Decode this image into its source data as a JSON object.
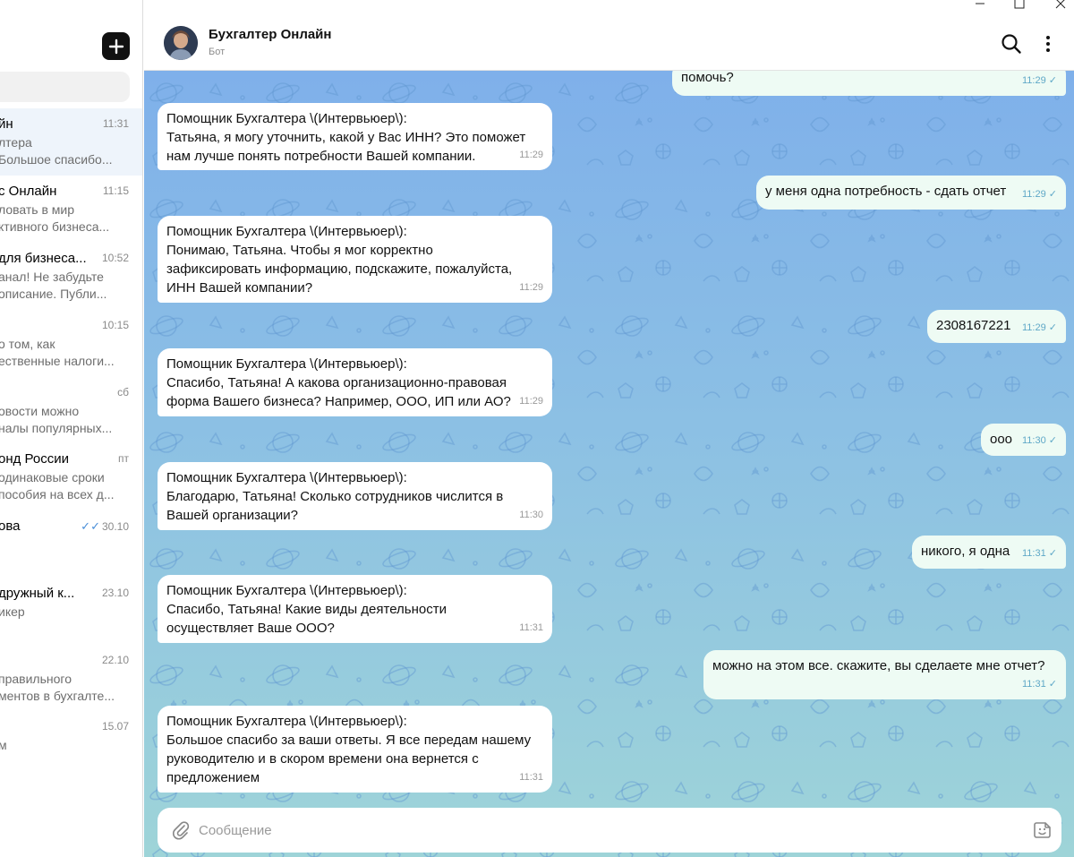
{
  "window": {
    "controls": [
      "minimize",
      "maximize",
      "close"
    ]
  },
  "sidebar": {
    "compose_icon": "plus-icon",
    "chats": [
      {
        "name": "йн",
        "time": "11:31",
        "line1": "лтера",
        "line2": "Большое спасибо...",
        "active": true
      },
      {
        "name": "с Онлайн",
        "time": "11:15",
        "line1": "ловать в мир",
        "line2": "ктивного бизнеса..."
      },
      {
        "name": "для бизнеса...",
        "time": "10:52",
        "line1": "анал!  Не забудьте",
        "line2": "описание. Публи..."
      },
      {
        "name": "",
        "time": "10:15",
        "line1": "о том, как",
        "line2": "ественные налоги..."
      },
      {
        "name": "",
        "time": "сб",
        "line1": "овости можно",
        "line2": "налы популярных..."
      },
      {
        "name": "онд России",
        "time": "пт",
        "line1": "одинаковые сроки",
        "line2": "пособия на всех д..."
      },
      {
        "name": "ова",
        "time": "30.10",
        "line1": "",
        "line2": "",
        "read": true
      },
      {
        "name": "дружный к...",
        "time": "23.10",
        "line1": "икер",
        "line2": ""
      },
      {
        "name": "",
        "time": "22.10",
        "line1": " правильного",
        "line2": "ментов в бухгалте..."
      },
      {
        "name": "",
        "time": "15.07",
        "line1": "м",
        "line2": ""
      }
    ]
  },
  "header": {
    "title": "Бухгалтер Онлайн",
    "subtitle": "Бот",
    "search_icon": "search-icon",
    "more_icon": "more-vertical-icon"
  },
  "messages": [
    {
      "dir": "out",
      "text": "помочь?",
      "time": "11:29",
      "read": true
    },
    {
      "dir": "in",
      "text": "Помощник Бухгалтера \\(Интервьюер\\):\nТатьяна, я могу уточнить, какой у Вас ИНН? Это поможет\nнам лучше понять потребности Вашей компании.",
      "time": "11:29"
    },
    {
      "dir": "out",
      "text": "у меня одна потребность - сдать отчет",
      "time": "11:29",
      "read": true
    },
    {
      "dir": "in",
      "text": "Помощник Бухгалтера \\(Интервьюер\\):\nПонимаю, Татьяна. Чтобы я мог корректно\nзафиксировать информацию, подскажите, пожалуйста,\nИНН Вашей компании?",
      "time": "11:29"
    },
    {
      "dir": "out",
      "text": "2308167221",
      "time": "11:29",
      "read": true
    },
    {
      "dir": "in",
      "text": "Помощник Бухгалтера \\(Интервьюер\\):\nСпасибо, Татьяна! А какова организационно-правовая\nформа Вашего бизнеса? Например, ООО, ИП или АО?",
      "time": "11:29"
    },
    {
      "dir": "out",
      "text": "ооо",
      "time": "11:30",
      "read": true
    },
    {
      "dir": "in",
      "text": "Помощник Бухгалтера \\(Интервьюер\\):\nБлагодарю, Татьяна! Сколько сотрудников числится в\nВашей организации?",
      "time": "11:30"
    },
    {
      "dir": "out",
      "text": "никого, я одна",
      "time": "11:31",
      "read": true
    },
    {
      "dir": "in",
      "text": "Помощник Бухгалтера \\(Интервьюер\\):\nСпасибо, Татьяна! Какие виды деятельности\nосуществляет Ваше ООО?",
      "time": "11:31"
    },
    {
      "dir": "out",
      "text": "можно на этом все. скажите, вы сделаете мне отчет?",
      "time": "11:31",
      "read": true
    },
    {
      "dir": "in",
      "text": "Помощник Бухгалтера \\(Интервьюер\\):\nБольшое спасибо за ваши ответы. Я все передам нашему\nруководителю и в скором времени она вернется с\nпредложением",
      "time": "11:31"
    }
  ],
  "composer": {
    "placeholder": "Сообщение",
    "attach_icon": "paperclip-icon",
    "sticker_icon": "sticker-icon"
  },
  "colors": {
    "chat_bg_top": "#7fb0ea",
    "chat_bg_bottom": "#9ed4d8",
    "outgoing_bubble": "#eefbf4",
    "incoming_bubble": "#ffffff",
    "read_check": "#5fa8c7"
  }
}
